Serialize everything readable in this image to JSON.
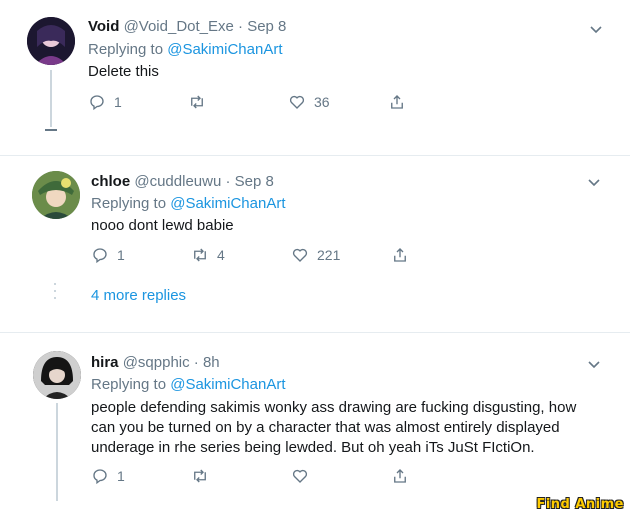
{
  "tweets": [
    {
      "name": "Void",
      "handle": "@Void_Dot_Exe",
      "dot": "·",
      "time": "Sep 8",
      "replying_prefix": "Replying to ",
      "replying_to": "@SakimiChanArt",
      "text": "Delete this",
      "replies": "1",
      "retweets": "",
      "likes": "36",
      "avatar_color": "#2c2040"
    },
    {
      "name": "chloe",
      "handle": "@cuddleuwu",
      "dot": "·",
      "time": "Sep 8",
      "replying_prefix": "Replying to ",
      "replying_to": "@SakimiChanArt",
      "text": "nooo dont lewd babie",
      "replies": "1",
      "retweets": "4",
      "likes": "221",
      "avatar_color": "#5a7a4a"
    },
    {
      "name": "hira",
      "handle": "@sqpphic",
      "dot": "·",
      "time": "8h",
      "replying_prefix": "Replying to ",
      "replying_to": "@SakimiChanArt",
      "text_lines": [
        "people defending sakimis wonky ass drawing are fucking disgusting, how",
        "can you be turned on by a character that was almost entirely displayed",
        "underage in rhe series being lewded. But oh yeah iTs JuSt FIctiOn."
      ],
      "replies": "1",
      "retweets": "",
      "likes": "",
      "avatar_color": "#1a1a1a"
    }
  ],
  "more_replies": "4 more replies",
  "watermark": "Find Anime",
  "colors": {
    "link": "#1b95e0",
    "muted": "#657786",
    "line": "#ccd6dd"
  }
}
